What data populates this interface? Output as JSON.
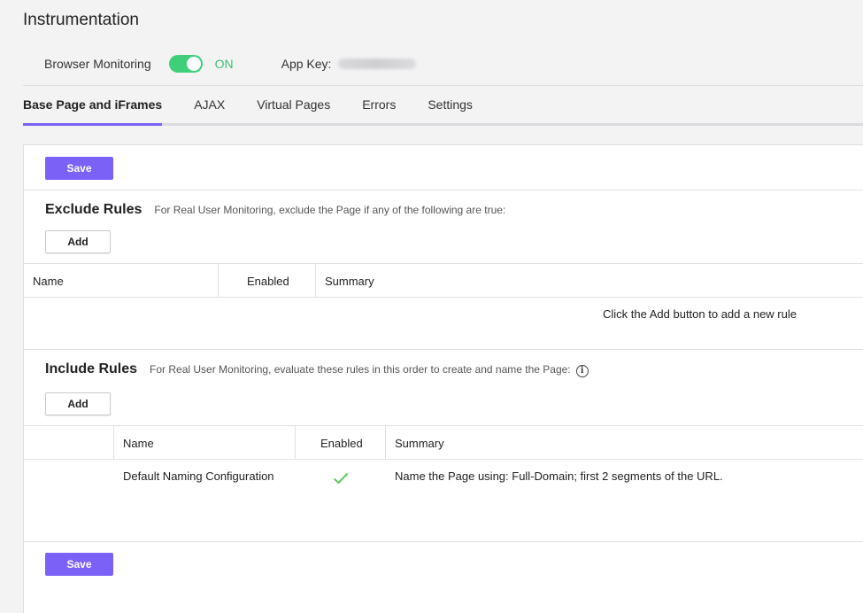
{
  "page": {
    "title": "Instrumentation"
  },
  "browser_monitoring": {
    "label": "Browser Monitoring",
    "toggle_state": "ON",
    "toggle_color": "#3fcf7b"
  },
  "app_key": {
    "label": "App Key:"
  },
  "tabs": [
    {
      "label": "Base Page and iFrames",
      "active": true
    },
    {
      "label": "AJAX"
    },
    {
      "label": "Virtual Pages"
    },
    {
      "label": "Errors"
    },
    {
      "label": "Settings"
    }
  ],
  "accent_color": "#7b61f5",
  "actions": {
    "save_label": "Save",
    "add_label": "Add"
  },
  "exclude_rules": {
    "title": "Exclude Rules",
    "description": "For Real User Monitoring, exclude the Page if any of the following are true:",
    "columns": [
      "Name",
      "Enabled",
      "Summary"
    ],
    "empty_message": "Click the Add button to add a new rule"
  },
  "include_rules": {
    "title": "Include Rules",
    "description": "For Real User Monitoring, evaluate these rules in this order to create and name the Page:",
    "columns": [
      "Name",
      "Enabled",
      "Summary"
    ],
    "rows": [
      {
        "name": "Default Naming Configuration",
        "enabled": true,
        "summary": "Name the Page using: Full-Domain; first 2 segments of the URL."
      }
    ]
  },
  "icons": {
    "info": "info-circle-icon",
    "check": "checkmark-icon"
  }
}
